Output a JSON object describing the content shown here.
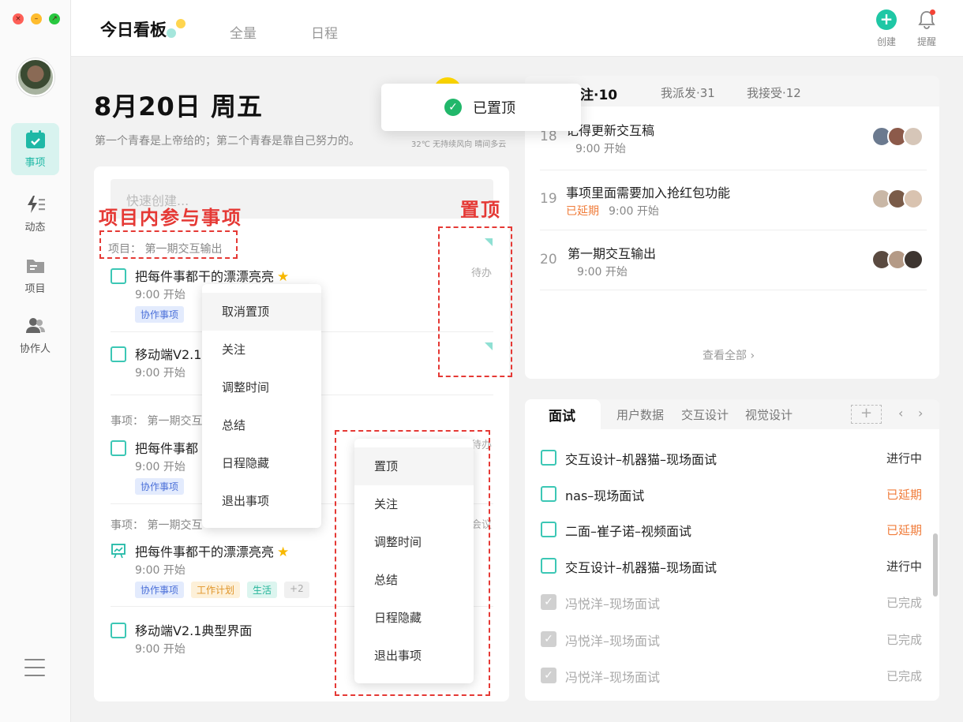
{
  "sidebar": {
    "items": [
      {
        "label": "事项"
      },
      {
        "label": "动态"
      },
      {
        "label": "项目"
      },
      {
        "label": "协作人"
      }
    ]
  },
  "topbar": {
    "tabs": [
      "今日看板",
      "全量",
      "日程"
    ],
    "create_label": "创建",
    "remind_label": "提醒"
  },
  "header": {
    "date": "8月20日 周五",
    "motto": "第一个青春是上帝给的；第二个青春是靠自己努力的。",
    "weather": "32℃ 无持续风向 晴间多云"
  },
  "quick_create": {
    "placeholder": "快速创建..."
  },
  "annotations": {
    "project_label": "项目内参与事项",
    "pin_label": "置顶"
  },
  "left_list": {
    "groups": [
      {
        "label": "项目：  第一期交互输出"
      },
      {
        "label": "事项：  第一期交互"
      },
      {
        "label": "事项：  第一期交互"
      }
    ],
    "tasks": [
      {
        "title": "把每件事都干的漂漂亮亮",
        "time": "9:00 开始",
        "tags": [
          "协作事项"
        ],
        "status": "待办"
      },
      {
        "title": "移动端V2.1",
        "time": "9:00 开始"
      },
      {
        "title": "把每件事都",
        "time": "9:00 开始",
        "tags": [
          "协作事项"
        ],
        "status": "待办"
      },
      {
        "title": "把每件事都干的漂漂亮亮",
        "time": "9:00 开始",
        "tags": [
          "协作事项",
          "工作计划",
          "生活",
          "+2"
        ],
        "status": "会议"
      },
      {
        "title": "移动端V2.1典型界面",
        "time": "9:00 开始"
      }
    ]
  },
  "context_menu_1": {
    "items": [
      "取消置顶",
      "关注",
      "调整时间",
      "总结",
      "日程隐藏",
      "退出事项"
    ]
  },
  "context_menu_2": {
    "items": [
      "置顶",
      "关注",
      "调整时间",
      "总结",
      "日程隐藏",
      "退出事项"
    ]
  },
  "toast": {
    "text": "已置顶"
  },
  "right_top": {
    "tabs": [
      "注·10",
      "我派发·31",
      "我接受·12"
    ],
    "rows": [
      {
        "num": "18",
        "title": "记得更新交互稿",
        "late": "",
        "time": "9:00 开始"
      },
      {
        "num": "19",
        "title": "事项里面需要加入抢红包功能",
        "late": "已延期",
        "time": "9:00 开始"
      },
      {
        "num": "20",
        "title": "第一期交互输出",
        "late": "",
        "time": "9:00 开始"
      }
    ],
    "see_all": "查看全部 ›"
  },
  "right_bottom": {
    "tabs": [
      "面试",
      "用户数据",
      "交互设计",
      "视觉设计"
    ],
    "add_label": "+",
    "rows": [
      {
        "name": "交互设计–机器猫–现场面试",
        "status": "进行中"
      },
      {
        "name": "nas–现场面试",
        "status": "已延期"
      },
      {
        "name": "二面–崔子诺–视频面试",
        "status": "已延期"
      },
      {
        "name": "交互设计–机器猫–现场面试",
        "status": "进行中"
      },
      {
        "name": "冯悦洋–现场面试",
        "status": "已完成"
      },
      {
        "name": "冯悦洋–现场面试",
        "status": "已完成"
      },
      {
        "name": "冯悦洋–现场面试",
        "status": "已完成"
      }
    ]
  },
  "colors": {
    "accent": "#1fc7a5",
    "late": "#f07c3a",
    "annotation": "#e53935"
  }
}
